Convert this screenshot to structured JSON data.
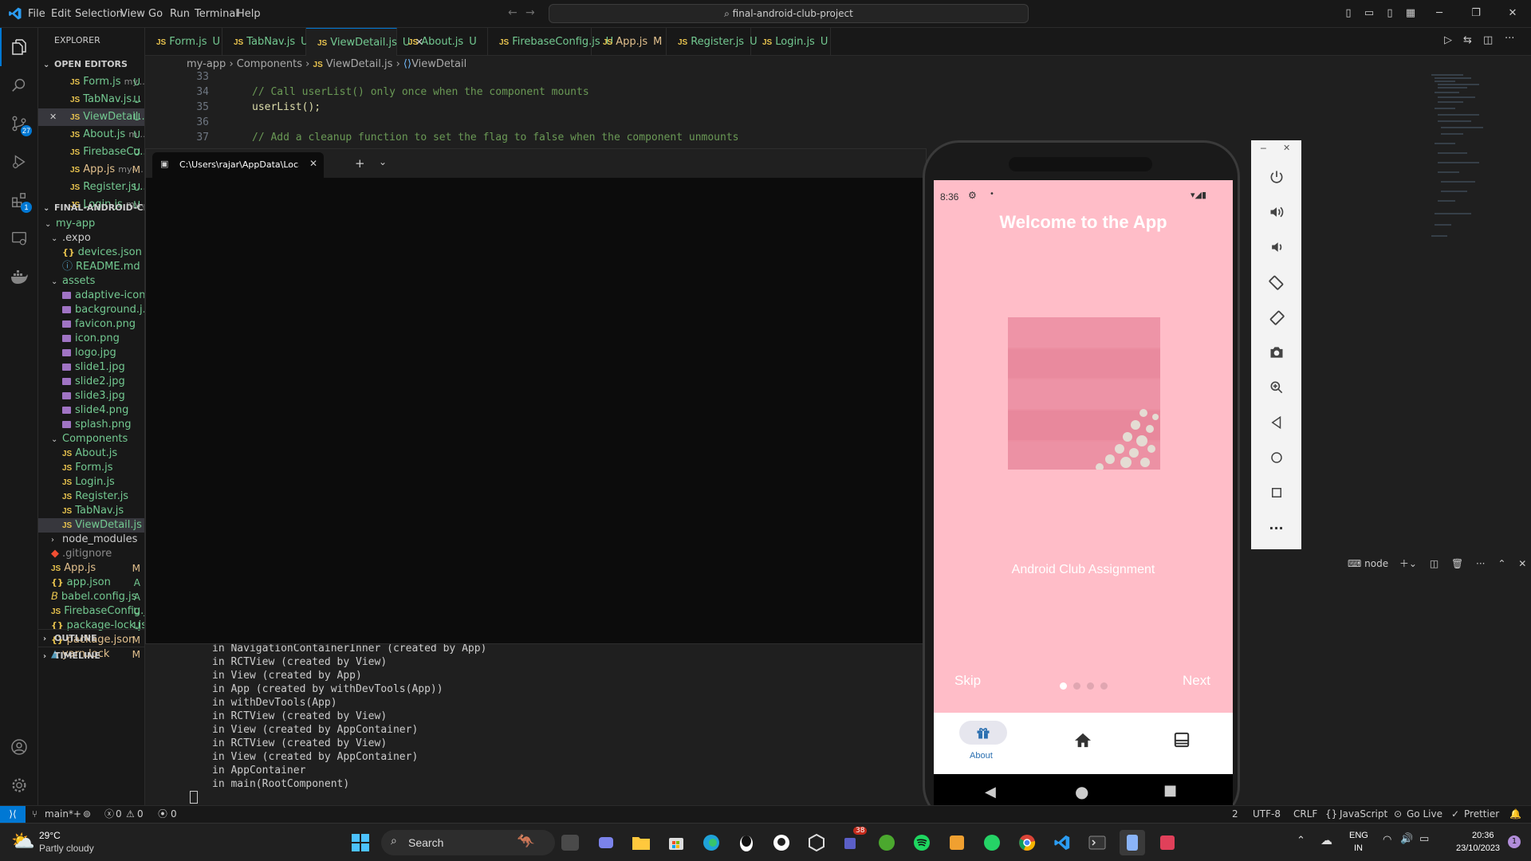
{
  "menu": [
    "File",
    "Edit",
    "Selection",
    "View",
    "Go",
    "Run",
    "Terminal",
    "Help"
  ],
  "search": {
    "text": "final-android-club-project"
  },
  "activity_badges": {
    "scm": "27",
    "extensions": "1"
  },
  "explorer": {
    "title": "EXPLORER",
    "open_editors_label": "OPEN EDITORS",
    "open_editors": [
      {
        "name": "Form.js",
        "hint": "my...",
        "status": "U"
      },
      {
        "name": "TabNav.js...",
        "hint": "",
        "status": "U"
      },
      {
        "name": "ViewDetail...",
        "hint": "",
        "status": "U"
      },
      {
        "name": "About.js",
        "hint": "m...",
        "status": "U"
      },
      {
        "name": "FirebaseCo...",
        "hint": "",
        "status": "U"
      },
      {
        "name": "App.js",
        "hint": "my-...",
        "status": "M"
      },
      {
        "name": "Register.js...",
        "hint": "",
        "status": "U"
      },
      {
        "name": "Login.js",
        "hint": "my...",
        "status": "U"
      }
    ],
    "project_label": "FINAL-ANDROID-CLU...",
    "tree": [
      {
        "name": "my-app",
        "kind": "folder",
        "status": ""
      },
      {
        "name": ".expo",
        "kind": "folder",
        "status": ""
      },
      {
        "name": "devices.json",
        "kind": "json",
        "status": ""
      },
      {
        "name": "README.md",
        "kind": "info",
        "status": ""
      },
      {
        "name": "assets",
        "kind": "folder",
        "status": ""
      },
      {
        "name": "adaptive-icon...",
        "kind": "img",
        "status": ""
      },
      {
        "name": "background.j...",
        "kind": "img",
        "status": ""
      },
      {
        "name": "favicon.png",
        "kind": "img",
        "status": ""
      },
      {
        "name": "icon.png",
        "kind": "img",
        "status": ""
      },
      {
        "name": "logo.jpg",
        "kind": "img",
        "status": ""
      },
      {
        "name": "slide1.jpg",
        "kind": "img",
        "status": ""
      },
      {
        "name": "slide2.jpg",
        "kind": "img",
        "status": ""
      },
      {
        "name": "slide3.jpg",
        "kind": "img",
        "status": ""
      },
      {
        "name": "slide4.png",
        "kind": "img",
        "status": ""
      },
      {
        "name": "splash.png",
        "kind": "img",
        "status": ""
      },
      {
        "name": "Components",
        "kind": "folder",
        "status": ""
      },
      {
        "name": "About.js",
        "kind": "js",
        "status": ""
      },
      {
        "name": "Form.js",
        "kind": "js",
        "status": ""
      },
      {
        "name": "Login.js",
        "kind": "js",
        "status": ""
      },
      {
        "name": "Register.js",
        "kind": "js",
        "status": ""
      },
      {
        "name": "TabNav.js",
        "kind": "js",
        "status": ""
      },
      {
        "name": "ViewDetail.js",
        "kind": "js",
        "status": ""
      },
      {
        "name": "node_modules",
        "kind": "folder-closed",
        "status": ""
      },
      {
        "name": ".gitignore",
        "kind": "git",
        "status": ""
      },
      {
        "name": "App.js",
        "kind": "js",
        "status": "M"
      },
      {
        "name": "app.json",
        "kind": "json",
        "status": "A"
      },
      {
        "name": "babel.config.js",
        "kind": "babel",
        "status": "A"
      },
      {
        "name": "FirebaseConfig.js",
        "kind": "js",
        "status": "U"
      },
      {
        "name": "package-lock.js...",
        "kind": "json",
        "status": "U"
      },
      {
        "name": "package.json",
        "kind": "json",
        "status": "M"
      },
      {
        "name": "yarn.lock",
        "kind": "yarn",
        "status": "M"
      }
    ],
    "outline": "OUTLINE",
    "timeline": "TIMELINE"
  },
  "tabs": [
    {
      "name": "Form.js",
      "status": "U"
    },
    {
      "name": "TabNav.js",
      "status": "U"
    },
    {
      "name": "ViewDetail.js",
      "status": "U"
    },
    {
      "name": "About.js",
      "status": "U"
    },
    {
      "name": "FirebaseConfig.js",
      "status": "U"
    },
    {
      "name": "App.js",
      "status": "M"
    },
    {
      "name": "Register.js",
      "status": "U"
    },
    {
      "name": "Login.js",
      "status": "U"
    }
  ],
  "breadcrumb": {
    "a": "my-app",
    "b": "Components",
    "c": "ViewDetail.js",
    "d": "ViewDetail"
  },
  "editor_lines": [
    {
      "n": "33",
      "text": ""
    },
    {
      "n": "34",
      "text": "// Call userList() only once when the component mounts"
    },
    {
      "n": "35",
      "text": "userList();"
    },
    {
      "n": "36",
      "text": ""
    },
    {
      "n": "37",
      "text": "// Add a cleanup function to set the flag to false when the component unmounts"
    }
  ],
  "terminal_window": {
    "tab_title": "C:\\Users\\rajar\\AppData\\Local"
  },
  "terminal_lines": [
    "in NavigationContainerInner (created by App)",
    "in RCTView (created by View)",
    "in View (created by App)",
    "in App (created by withDevTools(App))",
    "in withDevTools(App)",
    "in RCTView (created by View)",
    "in View (created by AppContainer)",
    "in RCTView (created by View)",
    "in View (created by AppContainer)",
    "in AppContainer",
    "in main(RootComponent)"
  ],
  "panel": {
    "terminal_name": "node"
  },
  "phone": {
    "time": "8:36",
    "title": "Welcome to the App",
    "caption": "Android Club Assignment",
    "skip": "Skip",
    "next": "Next",
    "tab_about": "About"
  },
  "statusbar": {
    "branch": "main*+",
    "errors": "0",
    "warnings": "0",
    "ports": "0",
    "ln": "2",
    "encoding": "UTF-8",
    "eol": "CRLF",
    "language": "JavaScript",
    "golive": "Go Live",
    "prettier": "Prettier"
  },
  "taskbar": {
    "weather_temp": "29°C",
    "weather_desc": "Partly cloudy",
    "search": "Search",
    "lang1": "ENG",
    "lang2": "IN",
    "time": "20:36",
    "date": "23/10/2023",
    "teams_badge": "38",
    "notif": "1"
  }
}
